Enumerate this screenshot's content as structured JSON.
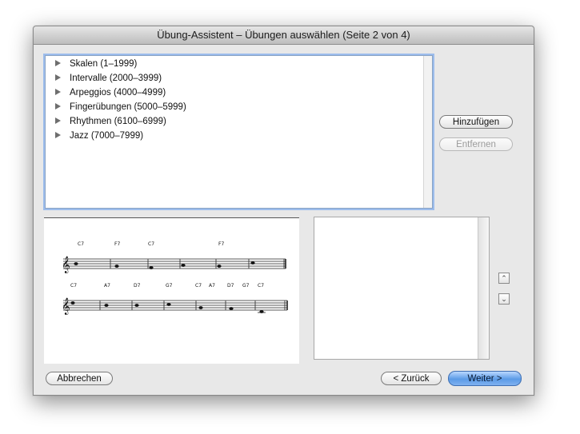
{
  "window": {
    "title": "Übung-Assistent – Übungen auswählen (Seite 2 von 4)"
  },
  "tree": {
    "items": [
      {
        "label": "Skalen (1–1999)"
      },
      {
        "label": "Intervalle (2000–3999)"
      },
      {
        "label": "Arpeggios (4000–4999)"
      },
      {
        "label": "Fingerübungen (5000–5999)"
      },
      {
        "label": "Rhythmen (6100–6999)"
      },
      {
        "label": "Jazz (7000–7999)"
      }
    ]
  },
  "buttons": {
    "add": "Hinzufügen",
    "remove": "Entfernen",
    "cancel": "Abbrechen",
    "back": "< Zurück",
    "next": "Weiter >"
  },
  "preview": {
    "staff1_chords": [
      "C7",
      "F7",
      "C7",
      "F7"
    ],
    "staff2_chords": [
      "C7",
      "A7",
      "D7",
      "G7",
      "C7",
      "A7",
      "D7",
      "G7",
      "C7"
    ]
  }
}
